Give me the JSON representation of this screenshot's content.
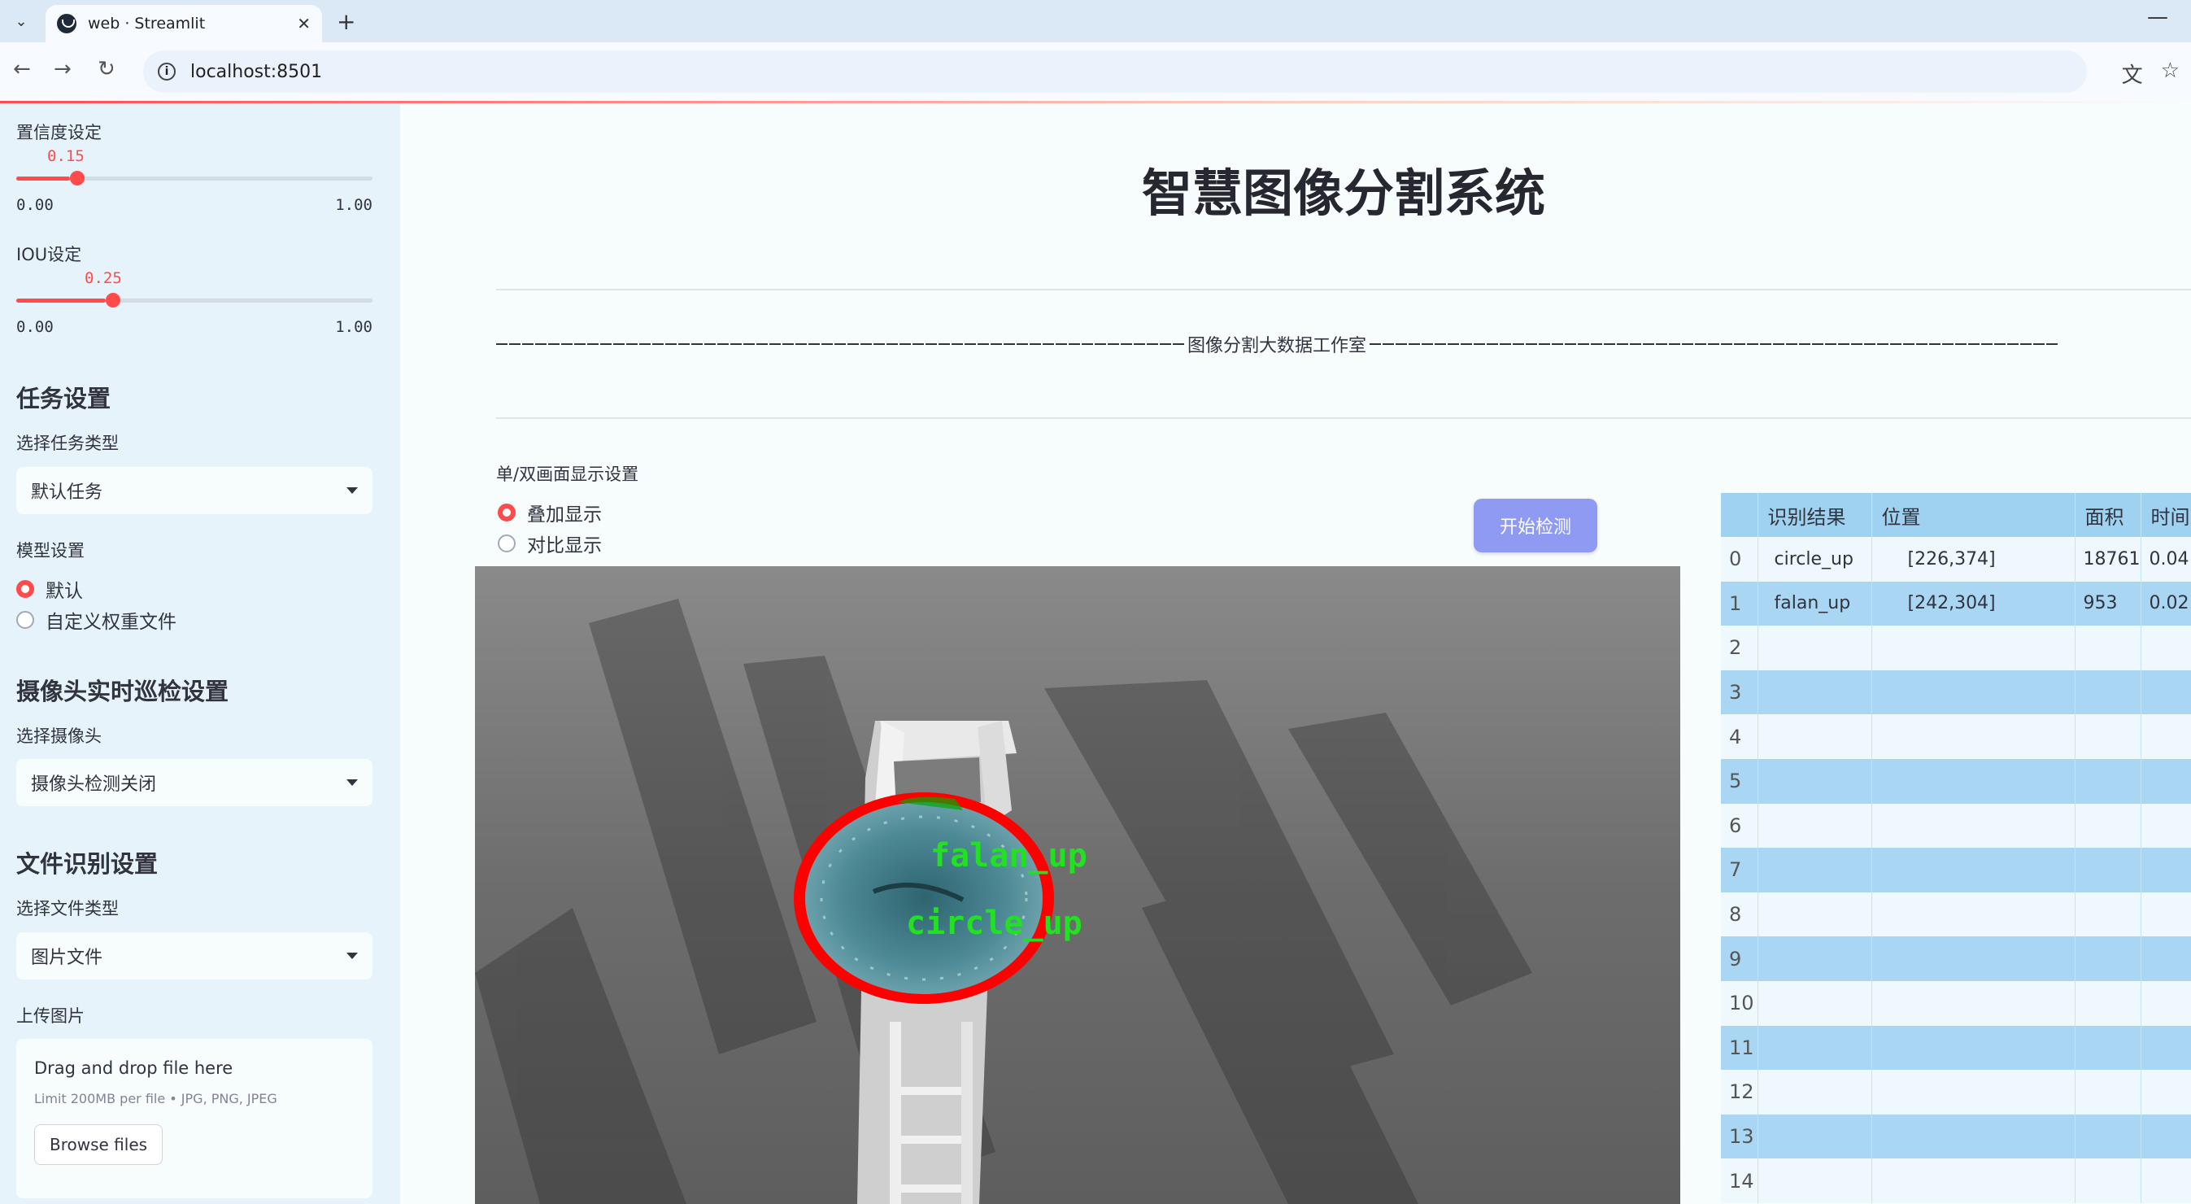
{
  "browser": {
    "tab_title": "web · Streamlit",
    "url": "localhost:8501"
  },
  "sidebar": {
    "confidence": {
      "label": "置信度设定",
      "value": "0.15",
      "min": "0.00",
      "max": "1.00",
      "fraction": 0.15
    },
    "iou": {
      "label": "IOU设定",
      "value": "0.25",
      "min": "0.00",
      "max": "1.00",
      "fraction": 0.25
    },
    "task_section": {
      "title": "任务设置",
      "select_label": "选择任务类型",
      "select_value": "默认任务"
    },
    "model_section": {
      "label": "模型设置",
      "options": [
        "默认",
        "自定义权重文件"
      ],
      "selected": 0
    },
    "camera_section": {
      "title": "摄像头实时巡检设置",
      "select_label": "选择摄像头",
      "select_value": "摄像头检测关闭"
    },
    "file_section": {
      "title": "文件识别设置",
      "select_label": "选择文件类型",
      "select_value": "图片文件"
    },
    "upload": {
      "label": "上传图片",
      "drop_text": "Drag and drop file here",
      "limit_text": "Limit 200MB per file • JPG, PNG, JPEG",
      "browse_label": "Browse files"
    }
  },
  "main": {
    "title": "智慧图像分割系统",
    "studio": "图像分割大数据工作室",
    "display_label": "单/双画面显示设置",
    "display_options": [
      "叠加显示",
      "对比显示"
    ],
    "display_selected": 0,
    "start_button": "开始检测",
    "image_labels": [
      "falan_up",
      "circle_up"
    ]
  },
  "table": {
    "columns": [
      "",
      "识别结果",
      "位置",
      "面积",
      "时间"
    ],
    "rows": [
      {
        "idx": "0",
        "result": "circle_up",
        "pos": "[226,374]",
        "area": "18761",
        "time": "0.04"
      },
      {
        "idx": "1",
        "result": "falan_up",
        "pos": "[242,304]",
        "area": "953",
        "time": "0.02"
      },
      {
        "idx": "2",
        "result": "",
        "pos": "",
        "area": "",
        "time": ""
      },
      {
        "idx": "3",
        "result": "",
        "pos": "",
        "area": "",
        "time": ""
      },
      {
        "idx": "4",
        "result": "",
        "pos": "",
        "area": "",
        "time": ""
      },
      {
        "idx": "5",
        "result": "",
        "pos": "",
        "area": "",
        "time": ""
      },
      {
        "idx": "6",
        "result": "",
        "pos": "",
        "area": "",
        "time": ""
      },
      {
        "idx": "7",
        "result": "",
        "pos": "",
        "area": "",
        "time": ""
      },
      {
        "idx": "8",
        "result": "",
        "pos": "",
        "area": "",
        "time": ""
      },
      {
        "idx": "9",
        "result": "",
        "pos": "",
        "area": "",
        "time": ""
      },
      {
        "idx": "10",
        "result": "",
        "pos": "",
        "area": "",
        "time": ""
      },
      {
        "idx": "11",
        "result": "",
        "pos": "",
        "area": "",
        "time": ""
      },
      {
        "idx": "12",
        "result": "",
        "pos": "",
        "area": "",
        "time": ""
      },
      {
        "idx": "13",
        "result": "",
        "pos": "",
        "area": "",
        "time": ""
      },
      {
        "idx": "14",
        "result": "",
        "pos": "",
        "area": "",
        "time": ""
      }
    ]
  },
  "colors": {
    "accent": "#ff4b4b",
    "button": "#8f9bf2",
    "table_header": "#9fd2f0",
    "detect_label": "#22e022",
    "detect_mask": "#ff0000"
  }
}
